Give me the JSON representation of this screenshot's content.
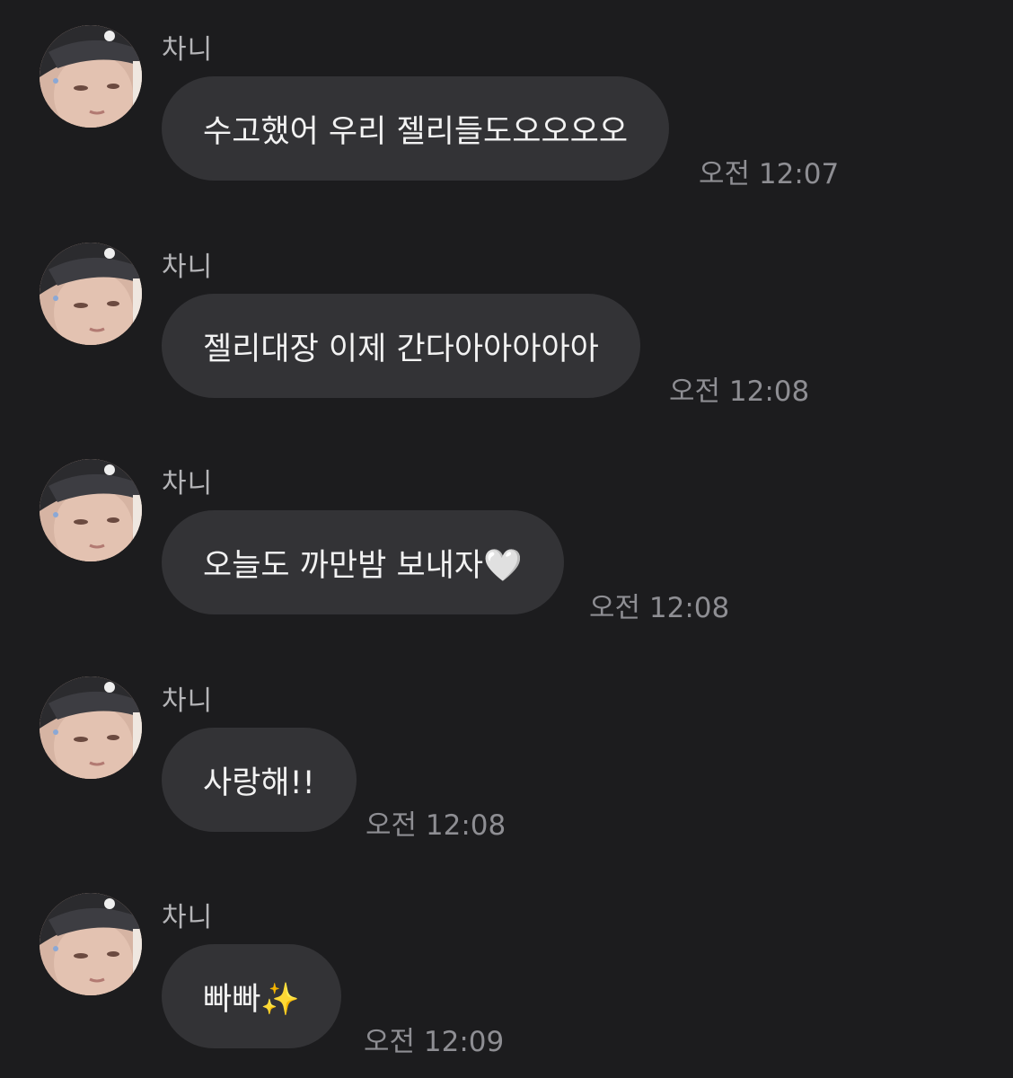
{
  "messages": [
    {
      "sender": "차니",
      "text": "수고했어 우리 젤리들도오오오오",
      "time": "오전 12:07"
    },
    {
      "sender": "차니",
      "text": "젤리대장 이제 간다아아아아아",
      "time": "오전 12:08"
    },
    {
      "sender": "차니",
      "text": "오늘도 까만밤 보내자🤍",
      "time": "오전 12:08"
    },
    {
      "sender": "차니",
      "text": "사랑해!!",
      "time": "오전 12:08"
    },
    {
      "sender": "차니",
      "text": "빠빠✨",
      "time": "오전 12:09"
    }
  ],
  "colors": {
    "background": "#1c1c1e",
    "bubble": "#333336",
    "text": "#f2f2f2",
    "sender": "#b5b5b8",
    "timestamp": "#8e8e93"
  },
  "icons": {
    "avatar": "profile-photo-avatar"
  }
}
